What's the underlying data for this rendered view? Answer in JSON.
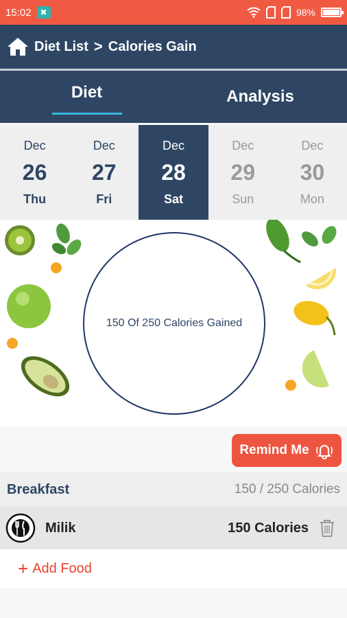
{
  "status_bar": {
    "time": "15:02",
    "battery": "98%",
    "battery_level": 0.98
  },
  "header": {
    "breadcrumb_parent": "Diet List",
    "breadcrumb_separator": ">",
    "breadcrumb_current": "Calories Gain"
  },
  "tabs": [
    {
      "label": "Diet",
      "active": true
    },
    {
      "label": "Analysis",
      "active": false
    }
  ],
  "dates": [
    {
      "month": "Dec",
      "day": "26",
      "weekday": "Thu",
      "state": "past"
    },
    {
      "month": "Dec",
      "day": "27",
      "weekday": "Fri",
      "state": "past"
    },
    {
      "month": "Dec",
      "day": "28",
      "weekday": "Sat",
      "state": "selected"
    },
    {
      "month": "Dec",
      "day": "29",
      "weekday": "Sun",
      "state": "future"
    },
    {
      "month": "Dec",
      "day": "30",
      "weekday": "Mon",
      "state": "future"
    }
  ],
  "progress": {
    "text": "150 Of 250 Calories Gained"
  },
  "remind": {
    "label": "Remind Me"
  },
  "meal": {
    "title": "Breakfast",
    "calories": "150 / 250 Calories",
    "items": [
      {
        "name": "Milik",
        "calories": "150 Calories"
      }
    ],
    "add_label": "Add Food"
  },
  "colors": {
    "status_bar": "#f05a43",
    "navy": "#2e4663",
    "accent_blue": "#3ab7e2",
    "remind_red": "#ee5540",
    "add_red": "#e8432f"
  }
}
